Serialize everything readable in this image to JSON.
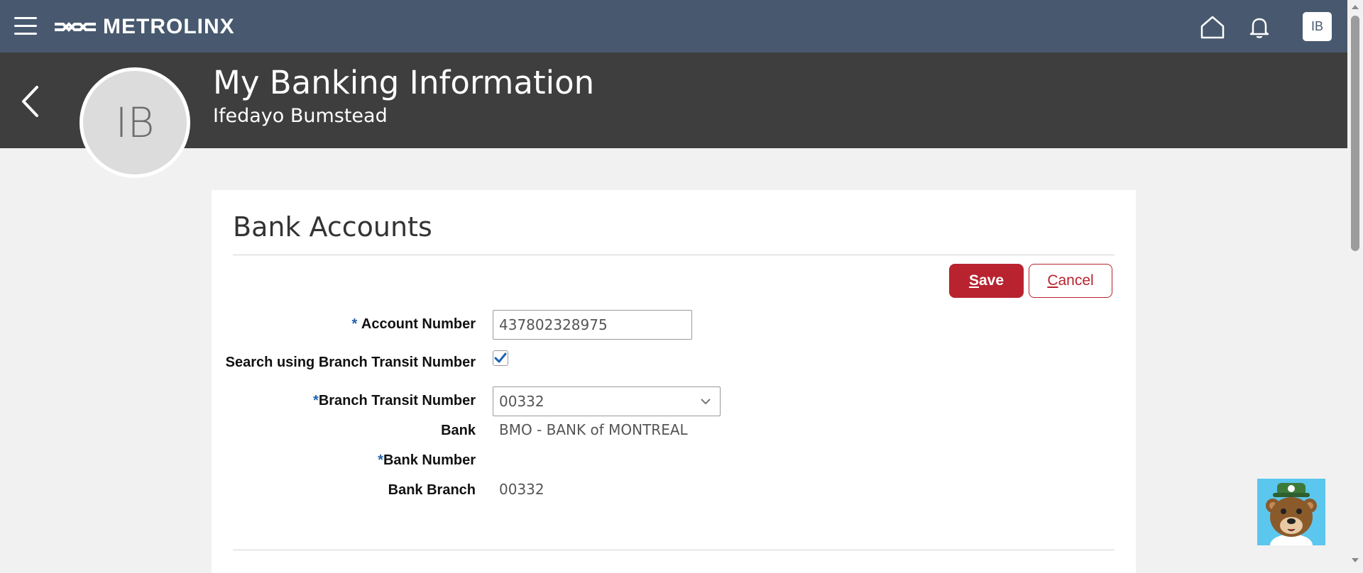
{
  "topbar": {
    "logo_text": "METROLINX",
    "user_initials": "IB",
    "bg_color": "#48596f"
  },
  "header": {
    "avatar_initials": "IB",
    "title": "My Banking Information",
    "subtitle": "Ifedayo Bumstead"
  },
  "card": {
    "title": "Bank Accounts",
    "save_label_accel": "S",
    "save_label_rest": "ave",
    "cancel_label_accel": "C",
    "cancel_label_rest": "ancel",
    "accent_color": "#b8232f"
  },
  "form": {
    "account_number": {
      "required_mark": "*",
      "label": "Account Number",
      "value": "437802328975"
    },
    "search_branch": {
      "label": "Search using Branch Transit Number",
      "checked": true
    },
    "branch_transit": {
      "required_mark": "*",
      "label": "Branch Transit Number",
      "value": "00332"
    },
    "bank": {
      "label": "Bank",
      "value": "BMO - BANK of MONTREAL"
    },
    "bank_number": {
      "required_mark": "*",
      "label": "Bank Number",
      "value": ""
    },
    "bank_branch": {
      "label": "Bank Branch",
      "value": "00332"
    }
  },
  "icons": {
    "menu": "hamburger-menu-icon",
    "home": "home-icon",
    "notifications": "bell-icon",
    "back": "chevron-left-icon",
    "dropdown": "chevron-down-icon",
    "checkbox": "checkmark-icon",
    "chatbot": "bear-mascot-icon"
  }
}
